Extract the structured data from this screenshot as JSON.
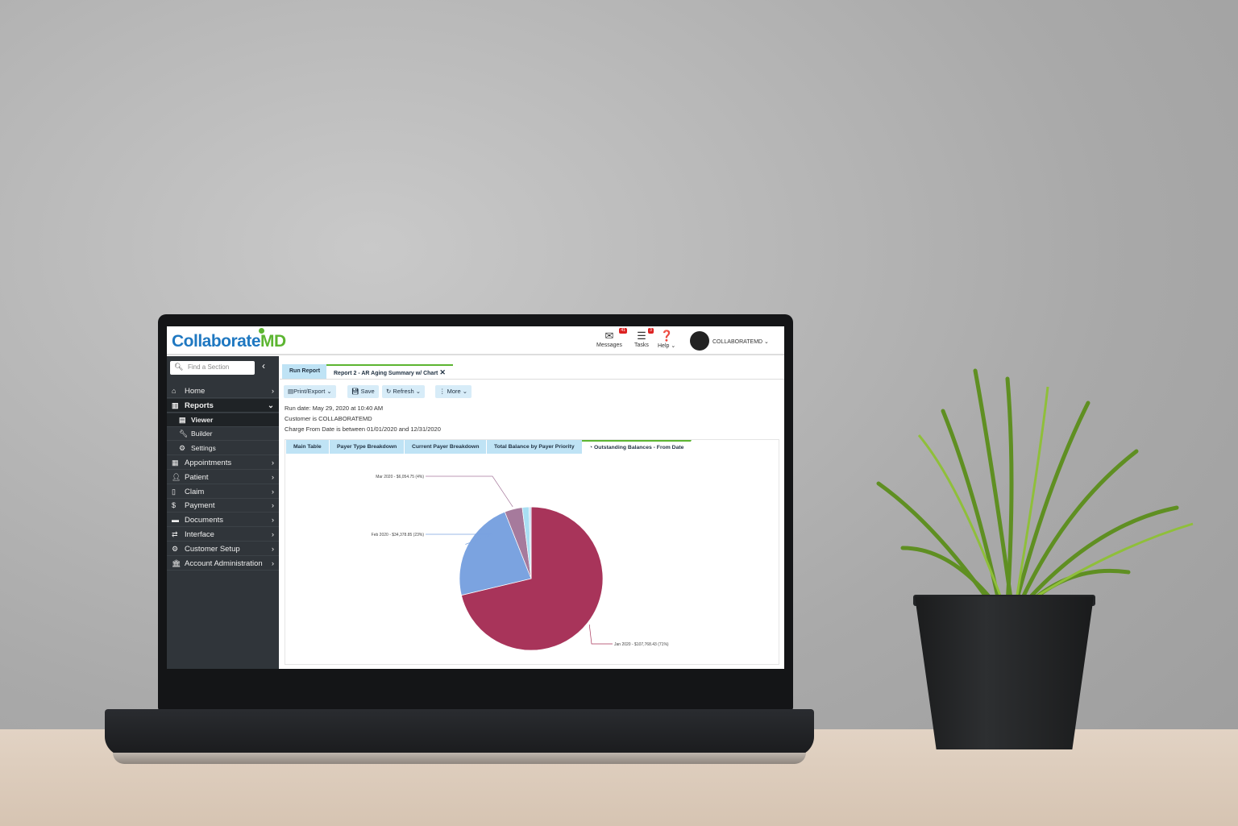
{
  "app": {
    "logo": "CollaborateMD"
  },
  "header": {
    "messages": {
      "label": "Messages",
      "count": "41"
    },
    "tasks": {
      "label": "Tasks",
      "count": "3"
    },
    "help": {
      "label": "Help"
    },
    "user": {
      "name": "COLLABORATEMD"
    }
  },
  "sidebar": {
    "search_placeholder": "Find a Section",
    "items": [
      {
        "label": "Home",
        "icon": "home-icon"
      },
      {
        "label": "Reports",
        "icon": "chart-icon"
      },
      {
        "label": "Viewer",
        "icon": "file-icon"
      },
      {
        "label": "Builder",
        "icon": "wrench-icon"
      },
      {
        "label": "Settings",
        "icon": "gear-icon"
      },
      {
        "label": "Appointments",
        "icon": "calendar-icon"
      },
      {
        "label": "Patient",
        "icon": "user-icon"
      },
      {
        "label": "Claim",
        "icon": "document-icon"
      },
      {
        "label": "Payment",
        "icon": "money-icon"
      },
      {
        "label": "Documents",
        "icon": "folder-icon"
      },
      {
        "label": "Interface",
        "icon": "exchange-icon"
      },
      {
        "label": "Customer Setup",
        "icon": "gears-icon"
      },
      {
        "label": "Account Administration",
        "icon": "bank-icon"
      }
    ]
  },
  "tabs": {
    "run": "Run Report",
    "report": "Report 2 - AR Aging Summary w/ Chart"
  },
  "toolbar": {
    "print": "Print/Export",
    "save": "Save",
    "refresh": "Refresh",
    "more": "More"
  },
  "meta": {
    "run_date": "Run date: May 29, 2020 at 10:40 AM",
    "customer": "Customer is COLLABORATEMD",
    "range": "Charge From Date is between 01/01/2020 and 12/31/2020"
  },
  "report_tabs": [
    "Main Table",
    "Payer Type Breakdown",
    "Current Payer Breakdown",
    "Total Balance by Payer Priority",
    "Outstanding Balances - From Date"
  ],
  "chart_data": {
    "type": "pie",
    "slices": [
      {
        "label": "Jan 2020 - $107,768.43 (71%)",
        "value": 107768.43,
        "color": "#a8345a"
      },
      {
        "label": "Feb 2020 - $34,378.85 (23%)",
        "value": 34378.85,
        "color": "#7ba3e0"
      },
      {
        "label": "Mar 2020 - $6,054.75 (4%)",
        "value": 6054.75,
        "color": "#a67a9c"
      },
      {
        "label": "",
        "value": 2300,
        "color": "#a9dff3"
      },
      {
        "label": "",
        "value": 700,
        "color": "#c8d8f0"
      }
    ]
  }
}
